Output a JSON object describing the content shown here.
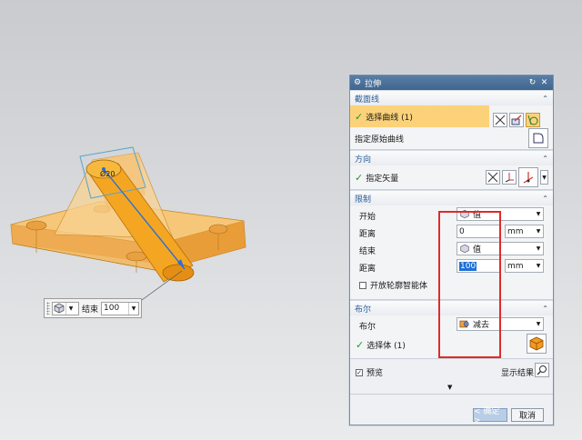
{
  "viewport": {
    "dimension_label": "Ø20"
  },
  "onscreen_input": {
    "label": "结束",
    "value": "100"
  },
  "dialog": {
    "title": "拉伸",
    "section_curve": {
      "title": "截面线",
      "select_curve_label": "选择曲线 (1)",
      "origin_curve_label": "指定原始曲线"
    },
    "section_direction": {
      "title": "方向",
      "vector_label": "指定矢量"
    },
    "section_limits": {
      "title": "限制",
      "start_label": "开始",
      "start_mode": "值",
      "start_distance_label": "距离",
      "start_distance": "0",
      "start_unit": "mm",
      "end_label": "结束",
      "end_mode": "值",
      "end_distance_label": "距离",
      "end_distance": "100",
      "end_unit": "mm",
      "open_profile_label": "开放轮廓智能体"
    },
    "section_boolean": {
      "title": "布尔",
      "boolean_label": "布尔",
      "boolean_value": "减去",
      "select_body_label": "选择体 (1)"
    },
    "preview_label": "预览",
    "show_result_label": "显示结果",
    "ok_label": "< 确定 >",
    "cancel_label": "取消"
  },
  "colors": {
    "title_bar": "#4a7099",
    "section_title": "#2e5d95",
    "highlight": "#fbd27a",
    "part": "#f4a623",
    "annotation_box": "#e02a2a"
  }
}
